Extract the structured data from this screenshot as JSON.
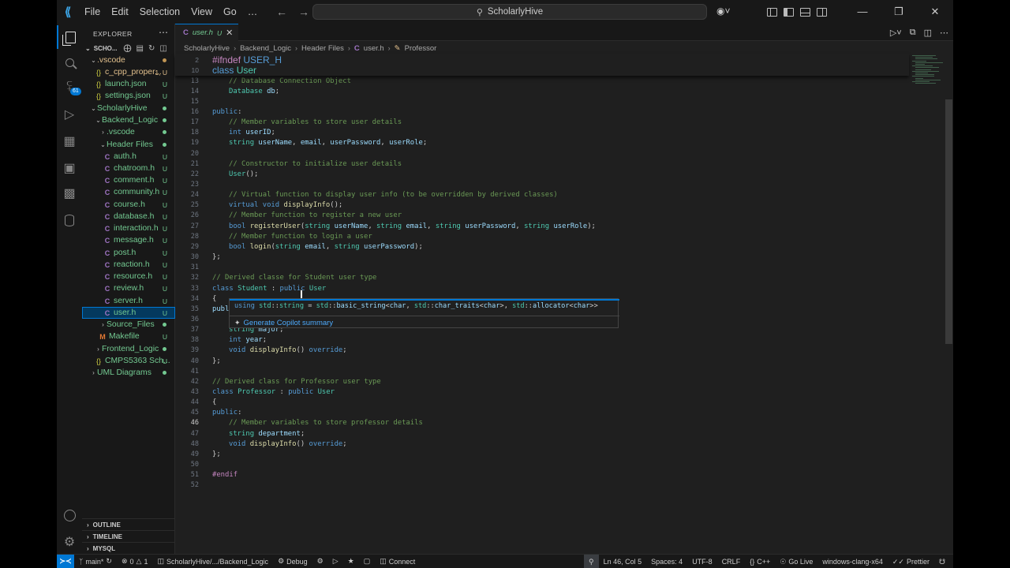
{
  "titlebar": {
    "menu": [
      "File",
      "Edit",
      "Selection",
      "View",
      "Go",
      "…"
    ],
    "search": "ScholarlyHive"
  },
  "activity": {
    "source_control_badge": "61"
  },
  "sidebar": {
    "title": "EXPLORER",
    "root": "SCHO...",
    "items": [
      {
        "label": ".vscode",
        "status": "",
        "dot": "mod"
      },
      {
        "label": "c_cpp_proper...",
        "status": "1, U"
      },
      {
        "label": "launch.json",
        "status": "U"
      },
      {
        "label": "settings.json",
        "status": "U"
      },
      {
        "label": "ScholarlyHive",
        "status": ""
      },
      {
        "label": "Backend_Logic",
        "status": ""
      },
      {
        "label": ".vscode",
        "status": ""
      },
      {
        "label": "Header Files",
        "status": ""
      },
      {
        "label": "auth.h",
        "status": "U"
      },
      {
        "label": "chatroom.h",
        "status": "U"
      },
      {
        "label": "comment.h",
        "status": "U"
      },
      {
        "label": "community.h",
        "status": "U"
      },
      {
        "label": "course.h",
        "status": "U"
      },
      {
        "label": "database.h",
        "status": "U"
      },
      {
        "label": "interaction.h",
        "status": "U"
      },
      {
        "label": "message.h",
        "status": "U"
      },
      {
        "label": "post.h",
        "status": "U"
      },
      {
        "label": "reaction.h",
        "status": "U"
      },
      {
        "label": "resource.h",
        "status": "U"
      },
      {
        "label": "review.h",
        "status": "U"
      },
      {
        "label": "server.h",
        "status": "U"
      },
      {
        "label": "user.h",
        "status": "U"
      },
      {
        "label": "Source_Files",
        "status": ""
      },
      {
        "label": "Makefile",
        "status": "U"
      },
      {
        "label": "Frontend_Logic",
        "status": ""
      },
      {
        "label": "CMPS5363 Sch...",
        "status": "U"
      },
      {
        "label": "UML Diagrams",
        "status": ""
      }
    ],
    "sections": [
      "OUTLINE",
      "TIMELINE",
      "MYSQL"
    ]
  },
  "tab": {
    "name": "user.h",
    "status": "U"
  },
  "breadcrumbs": [
    "ScholarlyHive",
    "Backend_Logic",
    "Header Files",
    "user.h",
    "Professor"
  ],
  "code": {
    "sticky": [
      {
        "n": "2",
        "text": "#ifndef USER_H"
      },
      {
        "n": "10",
        "text": "class User"
      }
    ],
    "lines": [
      {
        "n": "13",
        "text": "// Database Connection Object"
      },
      {
        "n": "14",
        "text": "Database db;"
      },
      {
        "n": "15",
        "text": ""
      },
      {
        "n": "16",
        "text": "public:"
      },
      {
        "n": "17",
        "text": "// Member variables to store user details"
      },
      {
        "n": "18",
        "text": "int userID;"
      },
      {
        "n": "19",
        "text": "string userName, email, userPassword, userRole;"
      },
      {
        "n": "20",
        "text": ""
      },
      {
        "n": "21",
        "text": "// Constructor to initialize user details"
      },
      {
        "n": "22",
        "text": "User();"
      },
      {
        "n": "23",
        "text": ""
      },
      {
        "n": "24",
        "text": "// Virtual function to display user info (to be overridden by derived classes)"
      },
      {
        "n": "25",
        "text": "virtual void displayInfo();"
      },
      {
        "n": "26",
        "text": "// Member function to register a new user"
      },
      {
        "n": "27",
        "text": "bool registerUser(string userName, string email, string userPassword, string userRole);"
      },
      {
        "n": "28",
        "text": "// Member function to login a user"
      },
      {
        "n": "29",
        "text": "bool login(string email, string userPassword);"
      },
      {
        "n": "30",
        "text": "};"
      },
      {
        "n": "31",
        "text": ""
      },
      {
        "n": "32",
        "text": "// Derived classe for Student user type"
      },
      {
        "n": "33",
        "text": "class Student : public User"
      },
      {
        "n": "34",
        "text": "{"
      },
      {
        "n": "35",
        "text": "publ"
      },
      {
        "n": "36",
        "text": ""
      },
      {
        "n": "37",
        "text": "string major;"
      },
      {
        "n": "38",
        "text": "int year;"
      },
      {
        "n": "39",
        "text": "void displayInfo() override;"
      },
      {
        "n": "40",
        "text": "};"
      },
      {
        "n": "41",
        "text": ""
      },
      {
        "n": "42",
        "text": "// Derived class for Professor user type"
      },
      {
        "n": "43",
        "text": "class Professor : public User"
      },
      {
        "n": "44",
        "text": "{"
      },
      {
        "n": "45",
        "text": "public:"
      },
      {
        "n": "46",
        "text": "// Member variables to store professor details"
      },
      {
        "n": "47",
        "text": "string department;"
      },
      {
        "n": "48",
        "text": "void displayInfo() override;"
      },
      {
        "n": "49",
        "text": "};"
      },
      {
        "n": "50",
        "text": ""
      },
      {
        "n": "51",
        "text": "#endif"
      },
      {
        "n": "52",
        "text": ""
      }
    ]
  },
  "hover": {
    "signature": "using std::string = std::basic_string<char, std::char_traits<char>, std::allocator<char>>",
    "action": "Generate Copilot summary"
  },
  "statusbar": {
    "branch": "main*",
    "problems": "0",
    "warnings": "1",
    "folder": "ScholarlyHive/.../Backend_Logic",
    "debug": "Debug",
    "connect": "Connect",
    "position": "Ln 46, Col 5",
    "spaces": "Spaces: 4",
    "encoding": "UTF-8",
    "eol": "CRLF",
    "language": "C++",
    "golive": "Go Live",
    "kit": "windows-clang-x64",
    "prettier": "Prettier"
  },
  "colors": {
    "accent": "#0078d4",
    "untracked": "#73c991",
    "keyword": "#569cd6",
    "comment": "#6a9955",
    "type": "#4ec9b0"
  }
}
